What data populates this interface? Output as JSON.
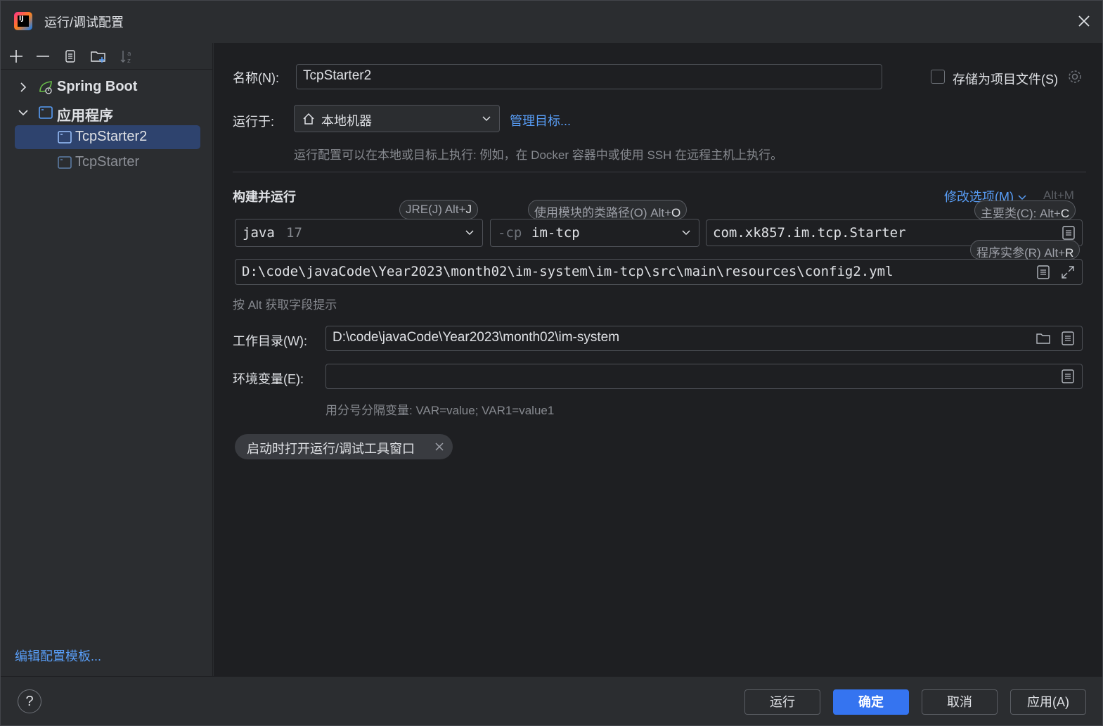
{
  "window": {
    "title": "运行/调试配置",
    "logo_text": "IJ"
  },
  "sidebar": {
    "items": [
      {
        "label": "Spring Boot",
        "icon": "spring-boot-icon",
        "expanded": false
      },
      {
        "label": "应用程序",
        "icon": "application-icon",
        "expanded": true
      },
      {
        "label": "TcpStarter2",
        "icon": "application-config-icon",
        "selected": true
      },
      {
        "label": "TcpStarter",
        "icon": "application-config-icon",
        "selected": false
      }
    ],
    "edit_templates": "编辑配置模板..."
  },
  "form": {
    "name_label": "名称(N):",
    "name_value": "TcpStarter2",
    "store_label": "存储为项目文件(S)",
    "run_on_label": "运行于:",
    "run_on_value": "本地机器",
    "manage_targets": "管理目标...",
    "run_on_hint": "运行配置可以在本地或目标上执行: 例如，在 Docker 容器中或使用 SSH 在远程主机上执行。",
    "build_run_title": "构建并运行",
    "modify_options": "修改选项(M)",
    "modify_shortcut": "Alt+M",
    "jre_hint_label": "JRE(J) Alt+",
    "jre_hint_key": "J",
    "jre_name": "java",
    "jre_version": "17",
    "module_hint_label": "使用模块的类路径(O) Alt+",
    "module_hint_key": "O",
    "cp_prefix": "-cp",
    "module_value": "im-tcp",
    "main_class_hint_label": "主要类(C): Alt+",
    "main_class_hint_key": "C",
    "main_class_value": "com.xk857.im.tcp.Starter",
    "args_hint_label": "程序实参(R) Alt+",
    "args_hint_key": "R",
    "args_value": "D:\\code\\javaCode\\Year2023\\month02\\im-system\\im-tcp\\src\\main\\resources\\config2.yml",
    "alt_hint": "按 Alt 获取字段提示",
    "workdir_label": "工作目录(W):",
    "workdir_value": "D:\\code\\javaCode\\Year2023\\month02\\im-system",
    "env_label": "环境变量(E):",
    "env_value": "",
    "env_hint": "用分号分隔变量: VAR=value; VAR1=value1",
    "chip_label": "启动时打开运行/调试工具窗口"
  },
  "buttons": {
    "help": "?",
    "run": "运行",
    "ok": "确定",
    "cancel": "取消",
    "apply": "应用(A)"
  },
  "colors": {
    "accent": "#3574f0",
    "link": "#589df6",
    "selected_row": "#2e436e"
  }
}
